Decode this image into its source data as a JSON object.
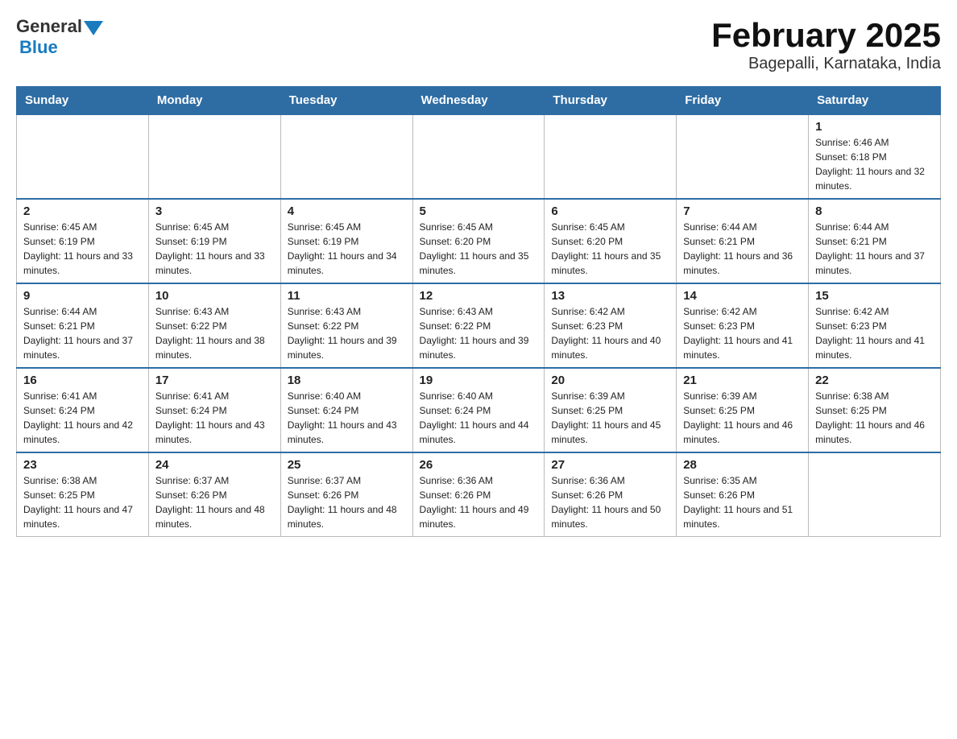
{
  "header": {
    "logo": {
      "general": "General",
      "blue": "Blue"
    },
    "title": "February 2025",
    "location": "Bagepalli, Karnataka, India"
  },
  "weekdays": [
    "Sunday",
    "Monday",
    "Tuesday",
    "Wednesday",
    "Thursday",
    "Friday",
    "Saturday"
  ],
  "weeks": [
    [
      {
        "day": "",
        "info": ""
      },
      {
        "day": "",
        "info": ""
      },
      {
        "day": "",
        "info": ""
      },
      {
        "day": "",
        "info": ""
      },
      {
        "day": "",
        "info": ""
      },
      {
        "day": "",
        "info": ""
      },
      {
        "day": "1",
        "info": "Sunrise: 6:46 AM\nSunset: 6:18 PM\nDaylight: 11 hours and 32 minutes."
      }
    ],
    [
      {
        "day": "2",
        "info": "Sunrise: 6:45 AM\nSunset: 6:19 PM\nDaylight: 11 hours and 33 minutes."
      },
      {
        "day": "3",
        "info": "Sunrise: 6:45 AM\nSunset: 6:19 PM\nDaylight: 11 hours and 33 minutes."
      },
      {
        "day": "4",
        "info": "Sunrise: 6:45 AM\nSunset: 6:19 PM\nDaylight: 11 hours and 34 minutes."
      },
      {
        "day": "5",
        "info": "Sunrise: 6:45 AM\nSunset: 6:20 PM\nDaylight: 11 hours and 35 minutes."
      },
      {
        "day": "6",
        "info": "Sunrise: 6:45 AM\nSunset: 6:20 PM\nDaylight: 11 hours and 35 minutes."
      },
      {
        "day": "7",
        "info": "Sunrise: 6:44 AM\nSunset: 6:21 PM\nDaylight: 11 hours and 36 minutes."
      },
      {
        "day": "8",
        "info": "Sunrise: 6:44 AM\nSunset: 6:21 PM\nDaylight: 11 hours and 37 minutes."
      }
    ],
    [
      {
        "day": "9",
        "info": "Sunrise: 6:44 AM\nSunset: 6:21 PM\nDaylight: 11 hours and 37 minutes."
      },
      {
        "day": "10",
        "info": "Sunrise: 6:43 AM\nSunset: 6:22 PM\nDaylight: 11 hours and 38 minutes."
      },
      {
        "day": "11",
        "info": "Sunrise: 6:43 AM\nSunset: 6:22 PM\nDaylight: 11 hours and 39 minutes."
      },
      {
        "day": "12",
        "info": "Sunrise: 6:43 AM\nSunset: 6:22 PM\nDaylight: 11 hours and 39 minutes."
      },
      {
        "day": "13",
        "info": "Sunrise: 6:42 AM\nSunset: 6:23 PM\nDaylight: 11 hours and 40 minutes."
      },
      {
        "day": "14",
        "info": "Sunrise: 6:42 AM\nSunset: 6:23 PM\nDaylight: 11 hours and 41 minutes."
      },
      {
        "day": "15",
        "info": "Sunrise: 6:42 AM\nSunset: 6:23 PM\nDaylight: 11 hours and 41 minutes."
      }
    ],
    [
      {
        "day": "16",
        "info": "Sunrise: 6:41 AM\nSunset: 6:24 PM\nDaylight: 11 hours and 42 minutes."
      },
      {
        "day": "17",
        "info": "Sunrise: 6:41 AM\nSunset: 6:24 PM\nDaylight: 11 hours and 43 minutes."
      },
      {
        "day": "18",
        "info": "Sunrise: 6:40 AM\nSunset: 6:24 PM\nDaylight: 11 hours and 43 minutes."
      },
      {
        "day": "19",
        "info": "Sunrise: 6:40 AM\nSunset: 6:24 PM\nDaylight: 11 hours and 44 minutes."
      },
      {
        "day": "20",
        "info": "Sunrise: 6:39 AM\nSunset: 6:25 PM\nDaylight: 11 hours and 45 minutes."
      },
      {
        "day": "21",
        "info": "Sunrise: 6:39 AM\nSunset: 6:25 PM\nDaylight: 11 hours and 46 minutes."
      },
      {
        "day": "22",
        "info": "Sunrise: 6:38 AM\nSunset: 6:25 PM\nDaylight: 11 hours and 46 minutes."
      }
    ],
    [
      {
        "day": "23",
        "info": "Sunrise: 6:38 AM\nSunset: 6:25 PM\nDaylight: 11 hours and 47 minutes."
      },
      {
        "day": "24",
        "info": "Sunrise: 6:37 AM\nSunset: 6:26 PM\nDaylight: 11 hours and 48 minutes."
      },
      {
        "day": "25",
        "info": "Sunrise: 6:37 AM\nSunset: 6:26 PM\nDaylight: 11 hours and 48 minutes."
      },
      {
        "day": "26",
        "info": "Sunrise: 6:36 AM\nSunset: 6:26 PM\nDaylight: 11 hours and 49 minutes."
      },
      {
        "day": "27",
        "info": "Sunrise: 6:36 AM\nSunset: 6:26 PM\nDaylight: 11 hours and 50 minutes."
      },
      {
        "day": "28",
        "info": "Sunrise: 6:35 AM\nSunset: 6:26 PM\nDaylight: 11 hours and 51 minutes."
      },
      {
        "day": "",
        "info": ""
      }
    ]
  ]
}
